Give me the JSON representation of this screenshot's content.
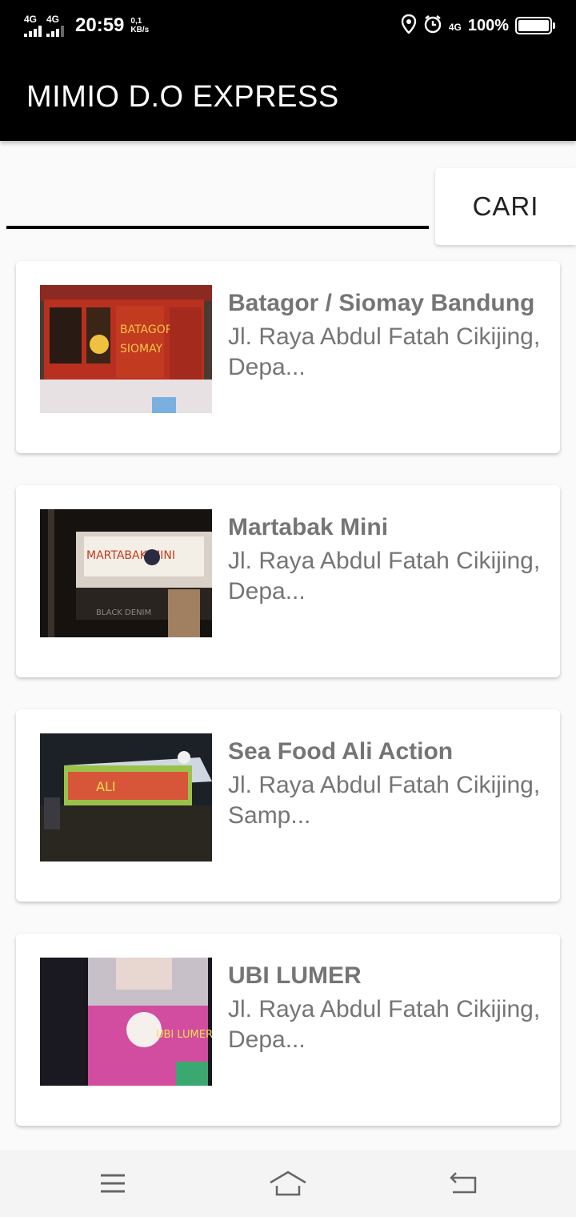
{
  "status_bar": {
    "sim1_label": "4G",
    "sim2_label": "4G",
    "time": "20:59",
    "net_speed_value": "0,1",
    "net_speed_unit": "KB/s",
    "data_label": "4G",
    "battery": "100%",
    "battery_level": 1.0,
    "icons": [
      "location-icon",
      "alarm-icon",
      "data-icon",
      "battery-icon"
    ]
  },
  "app_bar": {
    "title": "MIMIO D.O EXPRESS"
  },
  "search": {
    "value": "",
    "placeholder": "",
    "button_label": "CARI"
  },
  "cards": [
    {
      "name": "Batagor / Siomay Bandung",
      "address": "Jl. Raya Abdul Fatah Cikijing, Depa..."
    },
    {
      "name": "Martabak Mini",
      "address": "Jl. Raya Abdul Fatah Cikijing, Depa..."
    },
    {
      "name": "Sea Food Ali Action",
      "address": "Jl. Raya Abdul Fatah Cikijing, Samp..."
    },
    {
      "name": "UBI LUMER",
      "address": "Jl. Raya Abdul Fatah Cikijing, Depa..."
    }
  ],
  "nav_bar": {
    "icons": [
      "menu-icon",
      "home-icon",
      "back-icon"
    ]
  },
  "colors": {
    "app_bar": "#000000",
    "background": "#fafafa",
    "card_text": "#757575"
  }
}
